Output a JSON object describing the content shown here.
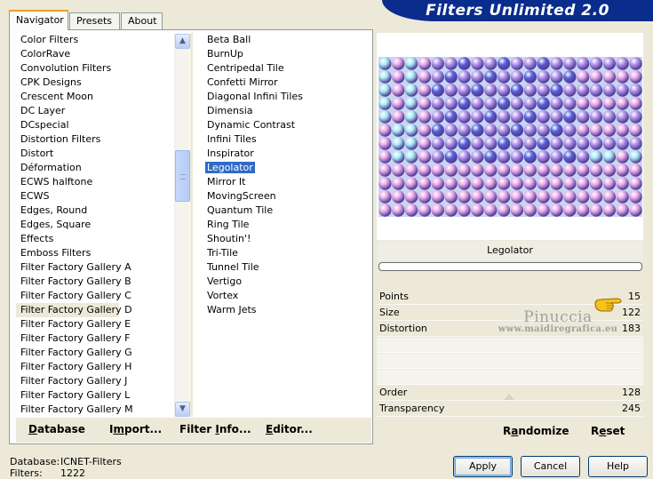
{
  "header": {
    "brand": "Filters Unlimited 2.0"
  },
  "tabs": [
    {
      "label": "Navigator",
      "active": true
    },
    {
      "label": "Presets",
      "active": false
    },
    {
      "label": "About",
      "active": false
    }
  ],
  "categories": {
    "selected": "Filter Factory Gallery D",
    "items": [
      "Color Filters",
      "ColorRave",
      "Convolution Filters",
      "CPK Designs",
      "Crescent Moon",
      "DC Layer",
      "DCspecial",
      "Distortion Filters",
      "Distort",
      "Déformation",
      "ECWS halftone",
      "ECWS",
      "Edges, Round",
      "Edges, Square",
      "Effects",
      "Emboss Filters",
      "Filter Factory Gallery A",
      "Filter Factory Gallery B",
      "Filter Factory Gallery C",
      "Filter Factory Gallery D",
      "Filter Factory Gallery E",
      "Filter Factory Gallery F",
      "Filter Factory Gallery G",
      "Filter Factory Gallery H",
      "Filter Factory Gallery J",
      "Filter Factory Gallery L",
      "Filter Factory Gallery M"
    ]
  },
  "filters": {
    "selected": "Legolator",
    "items": [
      "Beta Ball",
      "BurnUp",
      "Centripedal Tile",
      "Confetti Mirror",
      "Diagonal Infini Tiles",
      "Dimensia",
      "Dynamic Contrast",
      "Infini Tiles",
      "Inspirator",
      "Legolator",
      "Mirror It",
      "MovingScreen",
      "Quantum Tile",
      "Ring Tile",
      "Shoutin'!",
      "Tri-Tile",
      "Tunnel Tile",
      "Vertigo",
      "Vortex",
      "Warm Jets"
    ]
  },
  "left_buttons": {
    "database": {
      "u": "D",
      "rest": "atabase"
    },
    "import": {
      "pre": "I",
      "u": "m",
      "rest": "port..."
    },
    "filter_info": {
      "pre": "Filter ",
      "u": "I",
      "rest": "nfo..."
    },
    "editor": {
      "pre": "",
      "u": "E",
      "rest": "ditor..."
    }
  },
  "preview": {
    "title": "Legolator",
    "palette": {
      "pink": "#e8a8e8",
      "cyan": "#a8e8f4",
      "blue": "#5a60d8",
      "violet": "#b090e8"
    }
  },
  "params": {
    "points": {
      "label": "Points",
      "value": "15"
    },
    "size": {
      "label": "Size",
      "value": "122"
    },
    "distortion": {
      "label": "Distortion",
      "value": "183"
    },
    "order": {
      "label": "Order",
      "value": "128"
    },
    "transparency": {
      "label": "Transparency",
      "value": "245"
    }
  },
  "watermark": {
    "line1": "Pinuccia",
    "line2": "www.maidiregrafica.eu"
  },
  "right_buttons": {
    "randomize": {
      "pre": "R",
      "u": "a",
      "rest": "ndomize"
    },
    "reset": {
      "pre": "R",
      "u": "e",
      "rest": "set"
    }
  },
  "status": {
    "database_label": "Database:",
    "database_value": "ICNET-Filters",
    "filters_label": "Filters:",
    "filters_value": "1222"
  },
  "dialog_buttons": {
    "apply": "Apply",
    "cancel": "Cancel",
    "help": "Help"
  }
}
